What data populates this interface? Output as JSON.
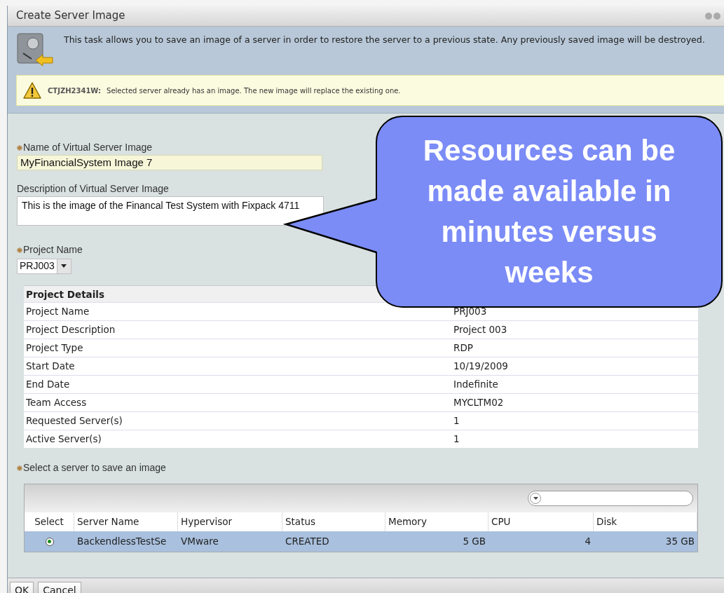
{
  "dialog": {
    "title": "Create Server Image",
    "intro": "This task allows you to save an image of a server in order to restore the server to a previous state. Any previously saved image will be destroyed.",
    "warning": {
      "code": "CTJZH2341W:",
      "message": "Selected server already has an image. The new image will replace the existing one."
    }
  },
  "fields": [
    {
      "label": "Name of Virtual Server Image",
      "required": true,
      "kind": "text",
      "value": "MyFinancialSystem Image 7"
    },
    {
      "label": "Description of Virtual Server Image",
      "required": false,
      "kind": "textarea",
      "value": "This is the image of the Financal Test System with Fixpack 4711"
    },
    {
      "label": "Project Name",
      "required": true,
      "kind": "select",
      "value": "PRJ003"
    }
  ],
  "project_details": {
    "title": "Project Details",
    "rows": [
      {
        "label": "Project Name",
        "value": "PRJ003"
      },
      {
        "label": "Project Description",
        "value": "Project 003"
      },
      {
        "label": "Project Type",
        "value": "RDP"
      },
      {
        "label": "Start Date",
        "value": "10/19/2009"
      },
      {
        "label": "End Date",
        "value": "Indefinite"
      },
      {
        "label": "Team Access",
        "value": "MYCLTM02"
      },
      {
        "label": "Requested Server(s)",
        "value": "1"
      },
      {
        "label": "Active Server(s)",
        "value": "1"
      }
    ]
  },
  "server_select": {
    "label": "Select a server to save an image",
    "required": true,
    "columns": [
      "Select",
      "Server Name",
      "Hypervisor",
      "Status",
      "Memory",
      "CPU",
      "Disk"
    ],
    "rows": [
      {
        "selected": true,
        "cells": [
          "",
          "BackendlessTestSe",
          "VMware",
          "CREATED",
          "5 GB",
          "4",
          "35 GB"
        ]
      }
    ]
  },
  "buttons": [
    "OK",
    "Cancel"
  ],
  "callout": {
    "text": "Resources can be made available in minutes versus weeks"
  }
}
